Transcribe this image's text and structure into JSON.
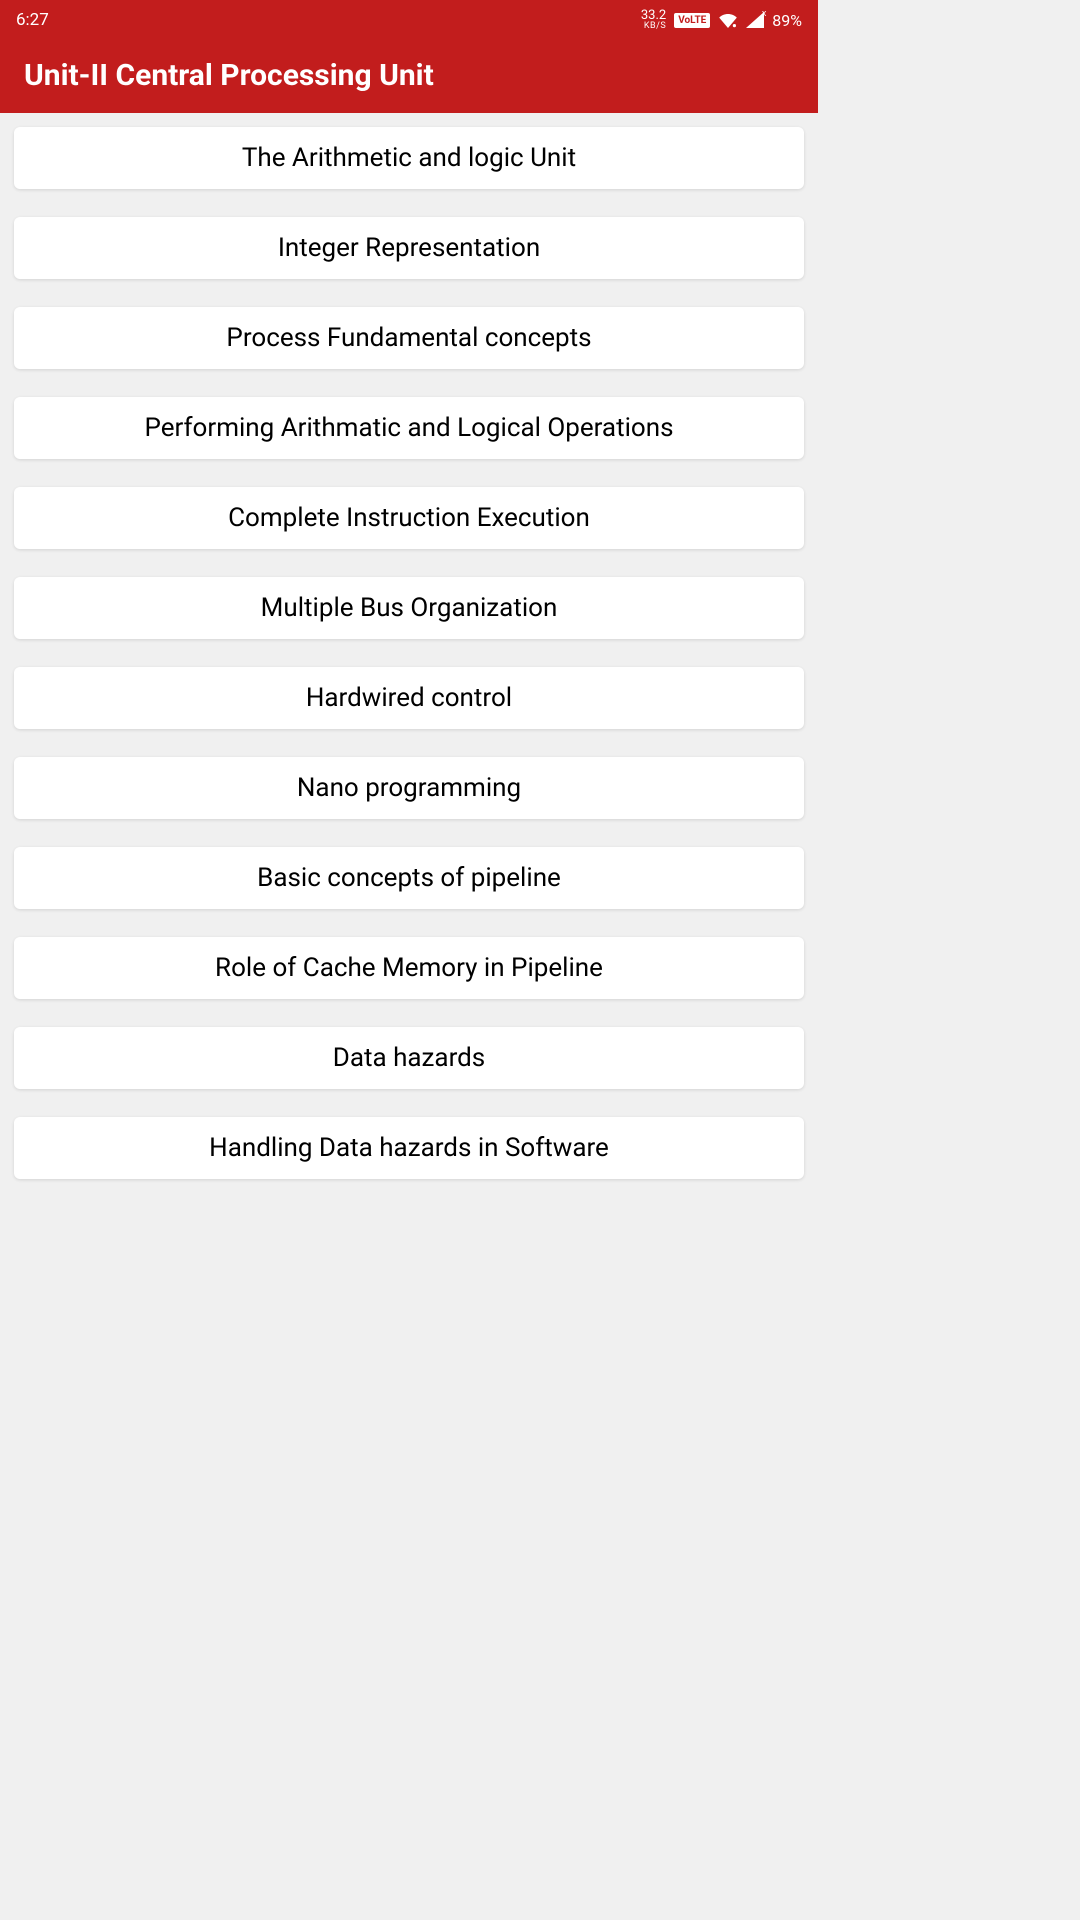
{
  "statusBar": {
    "time": "6:27",
    "networkSpeed": "33.2",
    "networkUnit": "KB/S",
    "volte": "VoLTE",
    "battery": "89%"
  },
  "header": {
    "title": "Unit-II Central Processing Unit"
  },
  "topics": [
    {
      "label": "The Arithmetic and logic Unit"
    },
    {
      "label": "Integer Representation"
    },
    {
      "label": "Process Fundamental concepts"
    },
    {
      "label": "Performing Arithmatic and Logical Operations"
    },
    {
      "label": "Complete Instruction Execution"
    },
    {
      "label": "Multiple Bus Organization"
    },
    {
      "label": "Hardwired control"
    },
    {
      "label": "Nano programming"
    },
    {
      "label": "Basic concepts of pipeline"
    },
    {
      "label": "Role of Cache Memory in Pipeline"
    },
    {
      "label": "Data hazards"
    },
    {
      "label": "Handling Data hazards in Software"
    }
  ]
}
